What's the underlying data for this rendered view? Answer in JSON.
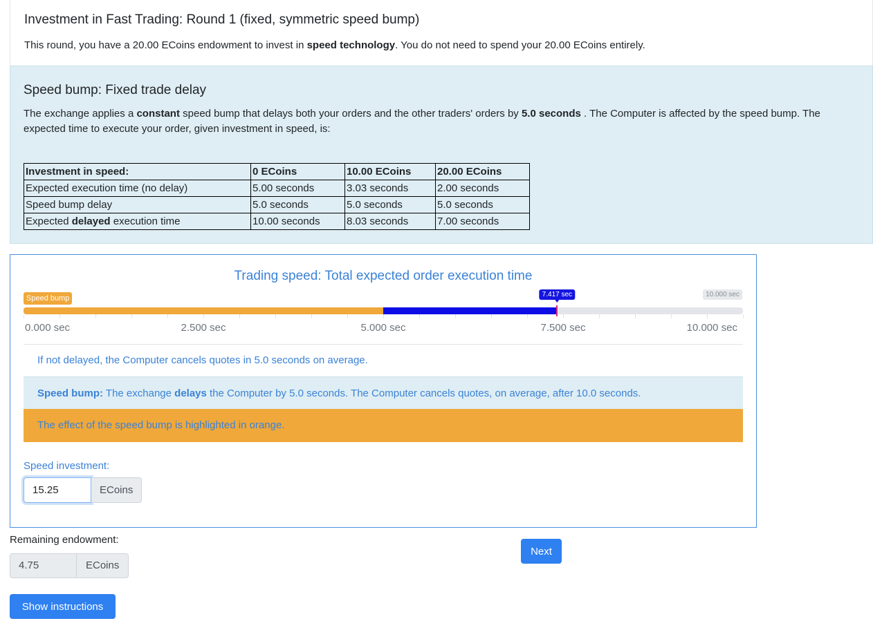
{
  "round": {
    "title": "Investment in Fast Trading: Round 1 (fixed, symmetric speed bump)",
    "text_pre": "This round, you have a 20.00 ECoins endowment to invest in ",
    "text_bold": "speed technology",
    "text_post": ". You do not need to spend your 20.00 ECoins entirely."
  },
  "speed_bump": {
    "title": "Speed bump: Fixed trade delay",
    "text_1": "The exchange applies a ",
    "text_bold_1": "constant",
    "text_2": " speed bump that delays both your orders and the other traders' orders by ",
    "text_bold_2": "5.0 seconds",
    "text_3": " . The Computer is affected by the speed bump. The expected time to execute your order, given investment in speed, is:",
    "table": {
      "headers": [
        "Investment in speed:",
        "0 ECoins",
        "10.00 ECoins",
        "20.00 ECoins"
      ],
      "row1": [
        "Expected execution time (no delay)",
        "5.00 seconds",
        "3.03 seconds",
        "2.00 seconds"
      ],
      "row2": [
        "Speed bump delay",
        "5.0 seconds",
        "5.0 seconds",
        "5.0 seconds"
      ],
      "row3_label_pre": "Expected ",
      "row3_label_bold": "delayed",
      "row3_label_post": " execution time",
      "row3": [
        "10.00 seconds",
        "8.03 seconds",
        "7.00 seconds"
      ]
    }
  },
  "trading_speed": {
    "title": "Trading speed: Total expected order execution time",
    "bump_chip": "Speed bump",
    "value_chip": "7.417 sec",
    "max_chip": "10.000 sec",
    "slider": {
      "min": 0,
      "max": 10,
      "bump_end": 5.0,
      "value": 7.417
    },
    "tick_labels": [
      "0.000 sec",
      "2.500 sec",
      "5.000 sec",
      "7.500 sec",
      "10.000 sec"
    ],
    "info_text": "If not delayed, the Computer cancels quotes in 5.0 seconds on average.",
    "bump_bold_1": "Speed bump:",
    "bump_text_1": " The exchange ",
    "bump_bold_2": "delays",
    "bump_text_2": " the Computer by 5.0 seconds. The Computer cancels quotes, on average, after 10.0 seconds.",
    "orange_text": "The effect of the speed bump is highlighted in orange.",
    "invest_label": "Speed investment:",
    "invest_value": "15.25",
    "invest_unit": "ECoins"
  },
  "bottom": {
    "remaining_label": "Remaining endowment:",
    "remaining_value": "4.75",
    "remaining_unit": "ECoins",
    "next_label": "Next",
    "instructions_label": "Show instructions"
  },
  "colors": {
    "accent": "#2f80f0",
    "bump": "#f0a83a",
    "investment": "#0d0de6",
    "info_bg": "#dfeef4"
  }
}
